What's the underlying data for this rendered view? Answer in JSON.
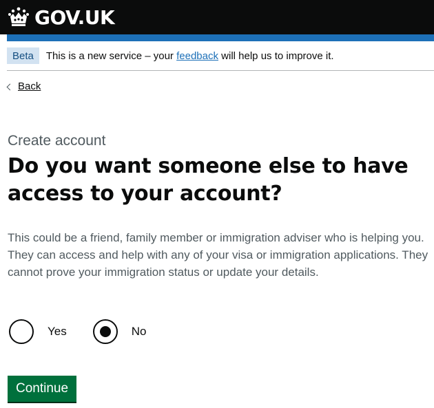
{
  "header": {
    "logo_text": "GOV.UK",
    "logo_icon": "crown-icon"
  },
  "phase_banner": {
    "tag": "Beta",
    "text_before": "This is a new service – your ",
    "link_text": "feedback",
    "text_after": " will help us to improve it."
  },
  "back_link": {
    "label": "Back"
  },
  "form": {
    "caption": "Create account",
    "heading": "Do you want someone else to have access to your account?",
    "hint": "This could be a friend, family member or immigration adviser who is helping you. They can access and help with any of your visa or immigration applications. They cannot prove your immigration status or update your details.",
    "options": [
      {
        "label": "Yes",
        "checked": false
      },
      {
        "label": "No",
        "checked": true
      }
    ],
    "continue_label": "Continue"
  },
  "colors": {
    "header_bg": "#0b0c0c",
    "blue_bar": "#1d70b8",
    "phase_tag_bg": "#d2e2f1",
    "link": "#1d70b8",
    "button_green": "#00703c",
    "secondary_text": "#505a5f"
  }
}
